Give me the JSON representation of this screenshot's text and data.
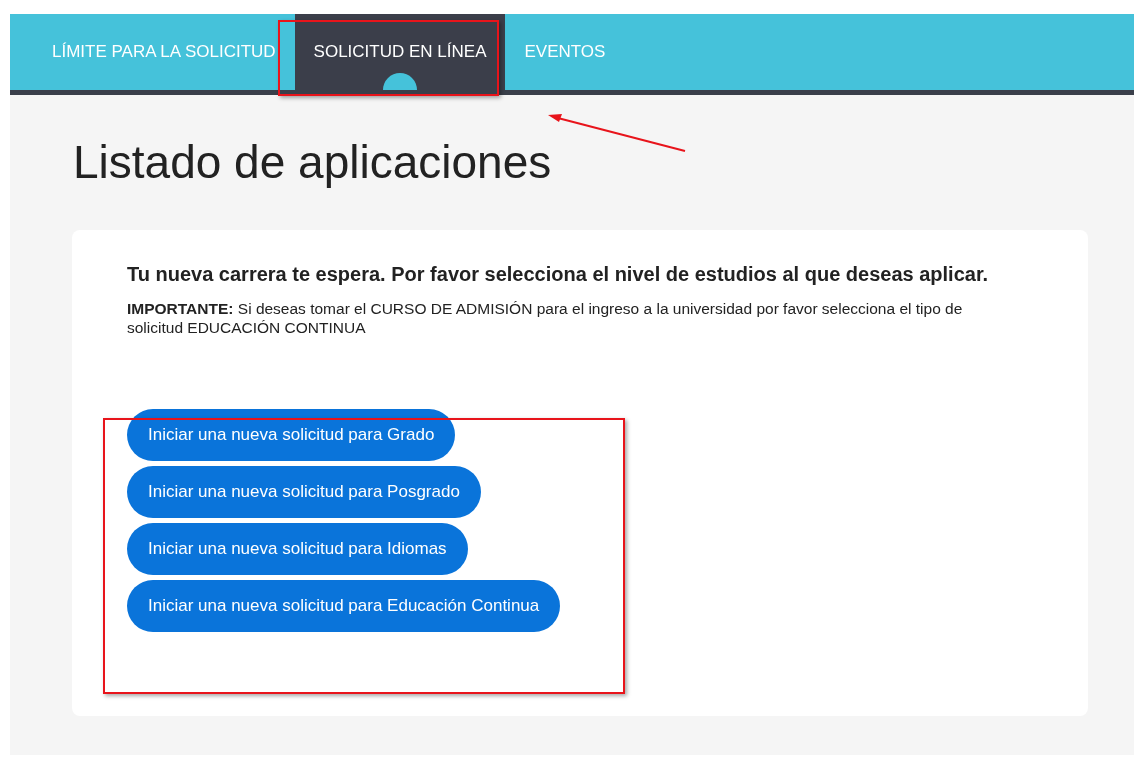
{
  "nav": {
    "tabs": [
      {
        "label": "LÍMITE PARA LA SOLICITUD",
        "selected": false
      },
      {
        "label": "SOLICITUD EN LÍNEA",
        "selected": true
      },
      {
        "label": "EVENTOS",
        "selected": false
      }
    ]
  },
  "page_title": "Listado de aplicaciones",
  "card": {
    "title": "Tu nueva carrera te espera. Por favor selecciona el nivel de estudios al que deseas aplicar.",
    "notice": "**IMPORTANTE:** Si deseas tomar el CURSO DE ADMISIÓN para el ingreso a la universidad por favor selecciona el tipo de solicitud EDUCACIÓN CONTINUA",
    "buttons": [
      "Iniciar una nueva solicitud para Grado",
      "Iniciar una nueva solicitud para Posgrado",
      "Iniciar una nueva solicitud para Idiomas",
      "Iniciar una nueva solicitud para Educación Continua"
    ]
  },
  "annotations": [
    {
      "kind": "box"
    },
    {
      "kind": "arrow"
    },
    {
      "kind": "box"
    }
  ]
}
